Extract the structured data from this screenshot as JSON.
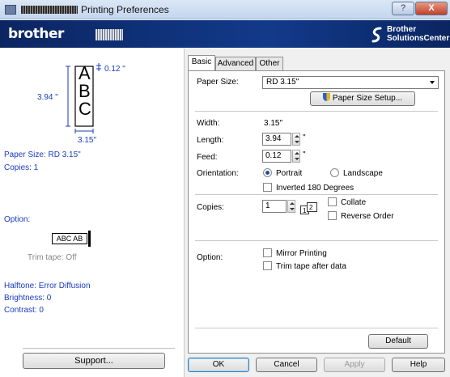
{
  "window": {
    "title": "Printing Preferences",
    "help_glyph": "?",
    "close_glyph": "X",
    "icons": {
      "app": "printer-icon",
      "help": "help-icon",
      "close": "close-icon"
    }
  },
  "header": {
    "brand": "brother",
    "solutions_line1": "Brother",
    "solutions_line2": "SolutionsCenter",
    "brand_color": "#0d2a6b"
  },
  "preview": {
    "letters": [
      "A",
      "B",
      "C"
    ],
    "margin_label": "0.12 \"",
    "height_label": "3.94 \"",
    "width_label": "3.15\""
  },
  "summary": {
    "paper_size": "Paper Size: RD 3.15\"",
    "copies": "Copies: 1",
    "option_title": "Option:",
    "tape_sample": "ABC AB",
    "trim_tape": "Trim tape: Off",
    "halftone": "Halftone: Error Diffusion",
    "brightness": "Brightness:  0",
    "contrast": "Contrast:  0",
    "support_button": "Support..."
  },
  "tabs": [
    {
      "label": "Basic",
      "active": true
    },
    {
      "label": "Advanced",
      "active": false
    },
    {
      "label": "Other",
      "active": false
    }
  ],
  "basic": {
    "paper_size_label": "Paper Size:",
    "paper_size_value": "RD 3.15\"",
    "paper_size_setup_button": "Paper Size Setup...",
    "width_label": "Width:",
    "width_value": "3.15\"",
    "length_label": "Length:",
    "length_value": "3.94",
    "length_unit": "\"",
    "feed_label": "Feed:",
    "feed_value": "0.12",
    "feed_unit": "\"",
    "orientation_label": "Orientation:",
    "portrait_label": "Portrait",
    "landscape_label": "Landscape",
    "orientation_selected": "Portrait",
    "inverted_label": "Inverted 180 Degrees",
    "inverted_checked": false,
    "copies_label": "Copies:",
    "copies_value": "1",
    "collate_label": "Collate",
    "collate_checked": false,
    "reverse_order_label": "Reverse Order",
    "reverse_order_checked": false,
    "option_label": "Option:",
    "mirror_printing_label": "Mirror Printing",
    "mirror_printing_checked": false,
    "trim_tape_after_data_label": "Trim tape after data",
    "trim_tape_after_data_checked": false,
    "default_button": "Default"
  },
  "footer": {
    "ok": "OK",
    "cancel": "Cancel",
    "apply": "Apply",
    "help": "Help"
  }
}
